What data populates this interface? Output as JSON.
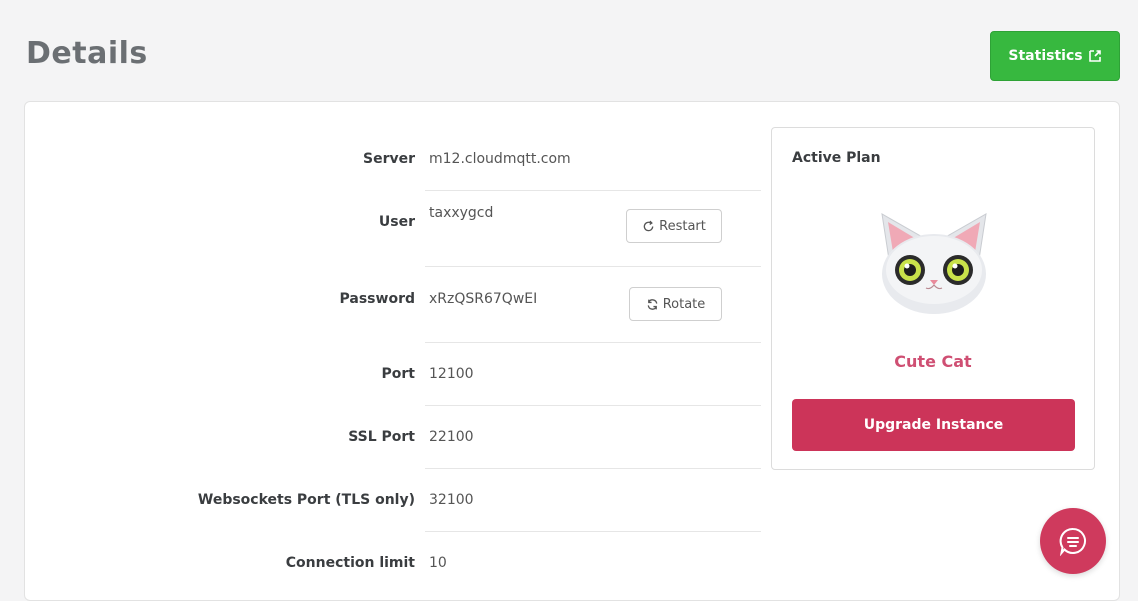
{
  "header": {
    "title": "Details",
    "statistics_label": "Statistics"
  },
  "details": {
    "server": {
      "label": "Server",
      "value": "m12.cloudmqtt.com"
    },
    "user": {
      "label": "User",
      "value": "taxxygcd",
      "action": "Restart"
    },
    "password": {
      "label": "Password",
      "value": "xRzQSR67QwEI",
      "action": "Rotate"
    },
    "port": {
      "label": "Port",
      "value": "12100"
    },
    "ssl_port": {
      "label": "SSL Port",
      "value": "22100"
    },
    "ws_port": {
      "label": "Websockets Port (TLS only)",
      "value": "32100"
    },
    "connection_limit": {
      "label": "Connection limit",
      "value": "10"
    }
  },
  "plan": {
    "title": "Active Plan",
    "name": "Cute Cat",
    "upgrade_label": "Upgrade Instance",
    "icon": "cat-mascot-icon"
  },
  "colors": {
    "green": "#37b83f",
    "crimson": "#cc3459",
    "plan_name": "#cf4f73"
  },
  "icons": {
    "statistics": "external-link-icon",
    "restart": "refresh-icon",
    "rotate": "rotate-icon",
    "chat": "chat-icon"
  }
}
